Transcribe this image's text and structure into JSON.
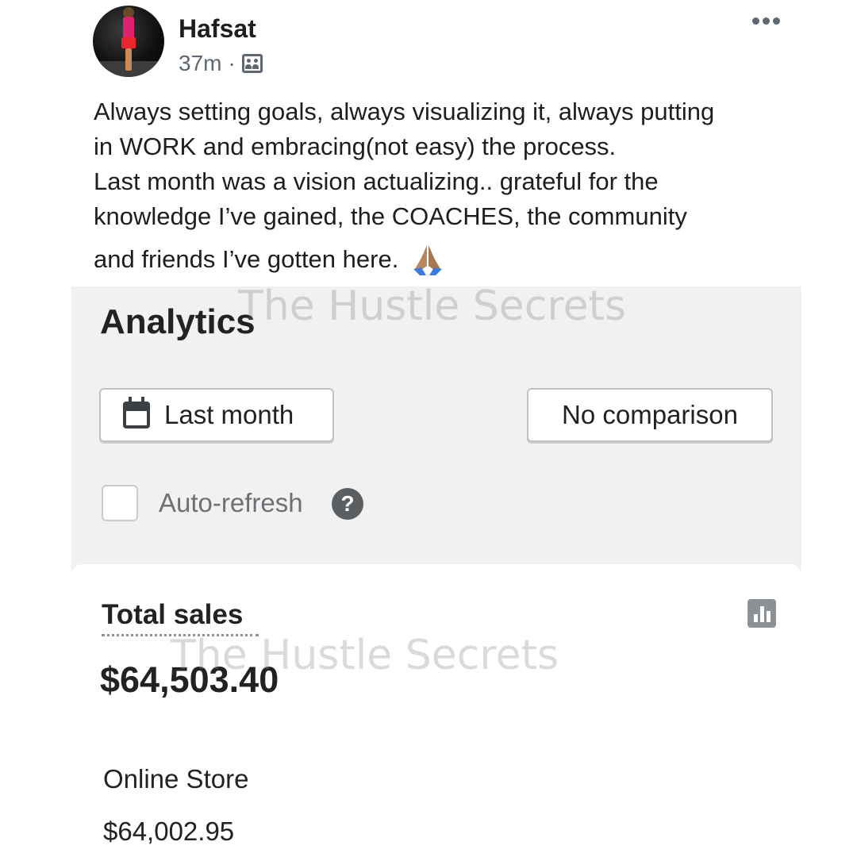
{
  "post": {
    "author": "Hafsat",
    "time": "37m",
    "separator": "·",
    "audience_icon": "group-icon",
    "more_icon": "more-options-icon",
    "text_lines": [
      "Always setting goals, always visualizing it, always putting",
      "in WORK and embracing(not easy) the process.",
      "Last month was a vision actualizing.. grateful for the",
      "knowledge I’ve gained, the COACHES, the community",
      "and friends I’ve gotten here."
    ],
    "emoji": "folded-hands-emoji"
  },
  "analytics": {
    "title": "Analytics",
    "date_button": "Last month",
    "date_icon": "calendar-icon",
    "compare_button": "No comparison",
    "auto_refresh_label": "Auto-refresh",
    "auto_refresh_checked": false,
    "help_icon": "?",
    "total_sales_label": "Total sales",
    "total_sales_value": "$64,503.40",
    "chart_icon": "bar-chart-icon",
    "online_store_label": "Online Store",
    "online_store_value": "$64,002.95"
  },
  "watermark": {
    "text": "The Hustle Secrets"
  }
}
